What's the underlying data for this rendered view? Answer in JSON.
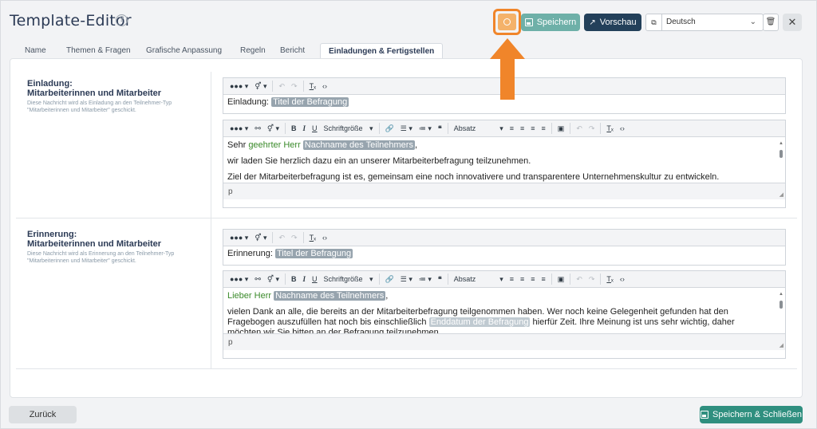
{
  "header": {
    "title": "Template-Editor",
    "help_icon": "?",
    "save_label": "Speichern",
    "preview_label": "Vorschau",
    "language": "Deutsch"
  },
  "tabs": [
    {
      "label": "Name"
    },
    {
      "label": "Themen & Fragen"
    },
    {
      "label": "Grafische Anpassung"
    },
    {
      "label": "Regeln"
    },
    {
      "label": "Bericht"
    },
    {
      "label": "Einladungen & Fertigstellen",
      "active": true
    }
  ],
  "toolbar": {
    "font_size": "Schriftgröße",
    "block_format": "Absatz"
  },
  "sections": [
    {
      "title_line1": "Einladung:",
      "title_line2": "Mitarbeiterinnen und Mitarbeiter",
      "description": "Diese Nachricht wird als Einladung an den Teilnehmer-Typ \"Mitarbeiterinnen und Mitarbeiter\" geschickt.",
      "subject_prefix": "Einladung:",
      "subject_tag": "Titel der Befragung",
      "greeting_green": "geehrter Herr",
      "greeting_start": "Sehr",
      "greeting_tag": "Nachname des Teilnehmers",
      "greeting_end": ",",
      "para1": "wir laden Sie herzlich dazu ein an unserer Mitarbeiterbefragung teilzunehmen.",
      "para2": "Ziel der Mitarbeiterbefragung ist es, gemeinsam eine noch innovativere und transparentere Unternehmenskultur zu entwickeln.",
      "status": "p"
    },
    {
      "title_line1": "Erinnerung:",
      "title_line2": "Mitarbeiterinnen und Mitarbeiter",
      "description": "Diese Nachricht wird als Erinnerung an den Teilnehmer-Typ \"Mitarbeiterinnen und Mitarbeiter\" geschickt.",
      "subject_prefix": "Erinnerung:",
      "subject_tag": "Titel der Befragung",
      "greeting_green": "Lieber Herr",
      "greeting_tag": "Nachname des Teilnehmers",
      "greeting_end": ",",
      "para1a": "vielen Dank an alle, die bereits an der Mitarbeiterbefragung teilgenommen haben. Wer noch keine Gelegenheit gefunden hat den Fragebogen auszufüllen hat noch bis einschließlich",
      "para1_tag": "Enddatum der Befragung",
      "para1b": "hierfür Zeit. Ihre Meinung ist uns sehr wichtig, daher möchten wir Sie bitten an der Befragung teilzunehmen.",
      "status": "p"
    }
  ],
  "footer": {
    "back_label": "Zurück",
    "save_close_label": "Speichern & Schließen"
  },
  "colors": {
    "accent_orange": "#f0852a",
    "save_teal": "#6eb0a8",
    "preview_navy": "#23405a",
    "save_close_green": "#2f8f7f"
  }
}
